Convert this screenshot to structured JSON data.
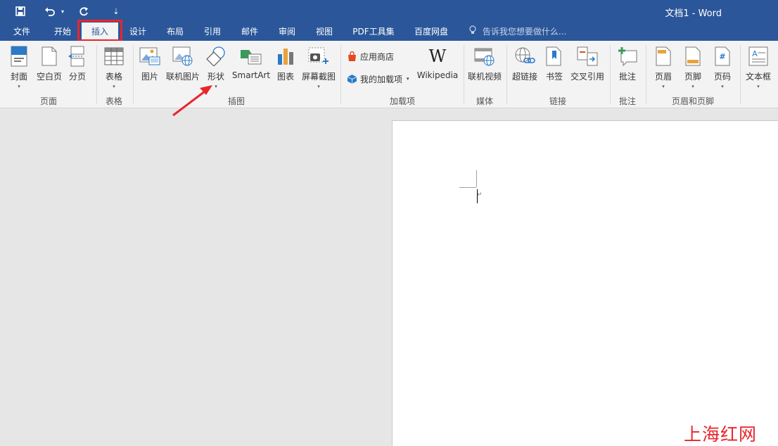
{
  "titlebar": {
    "title": "文档1 - Word",
    "customize_symbol": "⇣"
  },
  "tabs": [
    {
      "label": "文件"
    },
    {
      "label": "开始"
    },
    {
      "label": "插入"
    },
    {
      "label": "设计"
    },
    {
      "label": "布局"
    },
    {
      "label": "引用"
    },
    {
      "label": "邮件"
    },
    {
      "label": "审阅"
    },
    {
      "label": "视图"
    },
    {
      "label": "PDF工具集"
    },
    {
      "label": "百度网盘"
    }
  ],
  "active_tab": "插入",
  "tellme": {
    "text": "告诉我您想要做什么..."
  },
  "groups": {
    "pages": {
      "label": "页面",
      "buttons": [
        {
          "label": "封面"
        },
        {
          "label": "空白页"
        },
        {
          "label": "分页"
        }
      ]
    },
    "tables": {
      "label": "表格",
      "buttons": [
        {
          "label": "表格"
        }
      ]
    },
    "illustrations": {
      "label": "插图",
      "buttons": [
        {
          "label": "图片"
        },
        {
          "label": "联机图片"
        },
        {
          "label": "形状"
        },
        {
          "label": "SmartArt"
        },
        {
          "label": "图表"
        },
        {
          "label": "屏幕截图"
        }
      ]
    },
    "addins": {
      "label": "加载项",
      "buttons": [
        {
          "label": "应用商店"
        },
        {
          "label": "我的加载项"
        },
        {
          "label": "Wikipedia"
        }
      ]
    },
    "media": {
      "label": "媒体",
      "buttons": [
        {
          "label": "联机视频"
        }
      ]
    },
    "links": {
      "label": "链接",
      "buttons": [
        {
          "label": "超链接"
        },
        {
          "label": "书签"
        },
        {
          "label": "交叉引用"
        }
      ]
    },
    "comments": {
      "label": "批注",
      "buttons": [
        {
          "label": "批注"
        }
      ]
    },
    "header_footer": {
      "label": "页眉和页脚",
      "buttons": [
        {
          "label": "页眉"
        },
        {
          "label": "页脚"
        },
        {
          "label": "页码"
        }
      ]
    },
    "text": {
      "buttons": [
        {
          "label": "文本框"
        }
      ]
    }
  },
  "document": {
    "paragraph_mark": "↵"
  },
  "watermark": {
    "text": "上海红网"
  },
  "colors": {
    "accent": "#2b579a",
    "highlight": "#e8252b"
  }
}
